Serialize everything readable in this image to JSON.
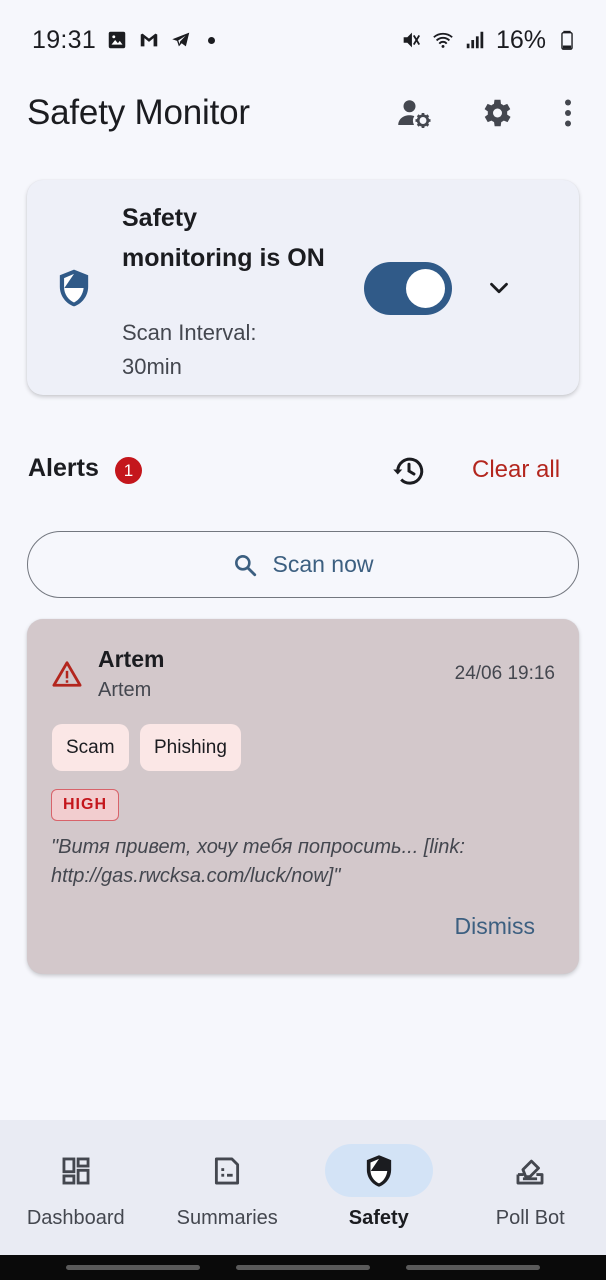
{
  "status_bar": {
    "time": "19:31",
    "battery": "16%",
    "icons": [
      "image-icon",
      "gmail-icon",
      "telegram-icon",
      "notification-dot",
      "mute-icon",
      "wifi-icon",
      "signal-icon",
      "battery-icon"
    ]
  },
  "app_bar": {
    "title": "Safety Monitor",
    "actions": [
      "manage-accounts-icon",
      "settings-icon",
      "more-vert-icon"
    ]
  },
  "monitor_card": {
    "title": "Safety monitoring is ON",
    "subtitle": "Scan Interval: 30min",
    "enabled": true,
    "icon": "shield-icon"
  },
  "alerts": {
    "title": "Alerts",
    "count": "1",
    "clear_all_label": "Clear all",
    "scan_now_label": "Scan now",
    "items": [
      {
        "sender": "Artem",
        "chat": "Artem",
        "time": "24/06 19:16",
        "tags": [
          "Scam",
          "Phishing"
        ],
        "severity": "HIGH",
        "snippet": "\"Витя привет, хочу тебя попросить... [link: http://gas.rwcksa.com/luck/now]\"",
        "dismiss_label": "Dismiss"
      }
    ]
  },
  "bottom_nav": {
    "items": [
      {
        "label": "Dashboard",
        "icon": "dashboard-icon",
        "active": false
      },
      {
        "label": "Summaries",
        "icon": "summaries-icon",
        "active": false
      },
      {
        "label": "Safety",
        "icon": "shield-icon",
        "active": true
      },
      {
        "label": "Poll Bot",
        "icon": "poll-icon",
        "active": false
      }
    ]
  },
  "colors": {
    "primary": "#305a88",
    "error": "#c4161c",
    "alert_card": "#d3c8cb",
    "active_indicator": "#d3e3f6"
  }
}
